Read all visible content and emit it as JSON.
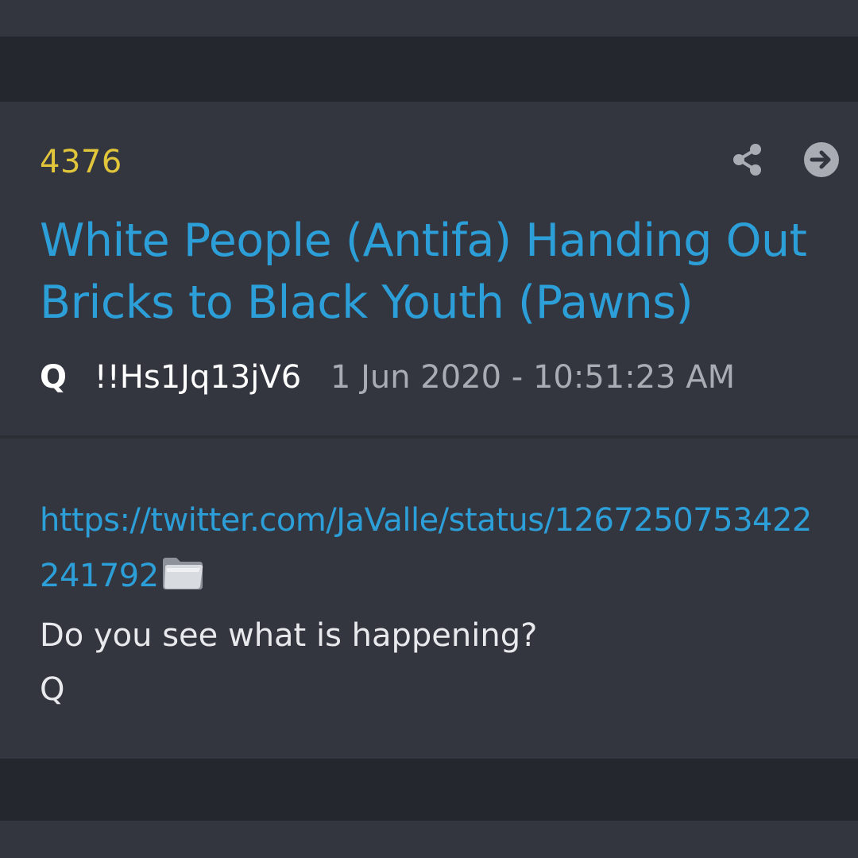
{
  "post": {
    "number": "4376",
    "title": "White People (Antifa) Handing Out Bricks to Black Youth (Pawns)",
    "author": "Q",
    "tripcode": "!!Hs1Jq13jV6",
    "timestamp": "1 Jun 2020 - 10:51:23 AM",
    "link": "https://twitter.com/JaValle/status/1267250753422241792",
    "body_lines": [
      "Do you see what is happening?",
      "Q"
    ]
  },
  "icons": {
    "share": "share-icon",
    "open": "arrow-right-circle-icon",
    "folder": "folder-icon"
  },
  "colors": {
    "post_number": "#e1c53a",
    "title": "#2d9fd8",
    "link": "#2d9fd8",
    "timestamp": "#a9acb3",
    "background": "#33363f",
    "band": "#24272d"
  }
}
